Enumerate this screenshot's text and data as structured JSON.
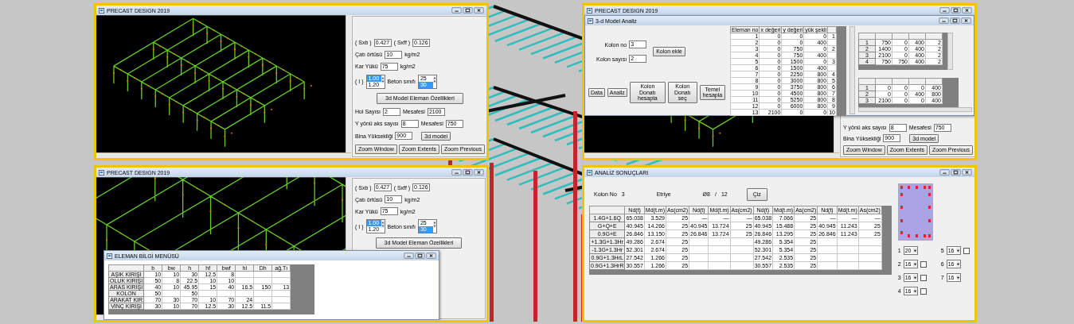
{
  "windows": [
    {
      "kind": "design",
      "title": "PRECAST DESIGN 2019",
      "panel": [
        {
          "kind": "pair",
          "items": [
            {
              "label": "( Sxb )",
              "value": "0.427"
            },
            {
              "label": "( Sxff )",
              "value": "0.126"
            }
          ]
        },
        {
          "kind": "field",
          "label": "Çatı örtüsü",
          "value": "10",
          "unit": "kg/m2"
        },
        {
          "kind": "field",
          "label": "Kar Yükü",
          "value": "75",
          "unit": "kg/m2"
        },
        {
          "kind": "lists",
          "items": [
            {
              "label": "( I )",
              "options": [
                {
                  "text": "1.00",
                  "selected": true
                },
                {
                  "text": "1.20",
                  "selected": false
                }
              ]
            },
            {
              "label": "Beton sınıfı",
              "options": [
                {
                  "text": "25",
                  "selected": false
                },
                {
                  "text": "30",
                  "selected": true
                }
              ]
            }
          ]
        },
        {
          "kind": "button",
          "label": "3d Model Eleman Özellikleri"
        },
        {
          "kind": "pair",
          "items": [
            {
              "label": "Hol Sayısı",
              "value": "2"
            },
            {
              "label": "Mesafesi",
              "value": "2100"
            }
          ]
        },
        {
          "kind": "pair",
          "items": [
            {
              "label": "Y yönü aks sayısı",
              "value": "8"
            },
            {
              "label": "Mesafesi",
              "value": "750"
            }
          ]
        },
        {
          "kind": "field-button",
          "label": "Bina Yüksekliği",
          "value": "900",
          "button": "3d model"
        },
        {
          "kind": "buttons",
          "labels": [
            "Zoom Window",
            "Zoom Extents",
            "Zoom Previous"
          ]
        }
      ]
    },
    {
      "kind": "design",
      "title": "PRECAST DESIGN 2019",
      "panel": [
        {
          "kind": "pair",
          "items": [
            {
              "label": "Y yönü aks sayısı",
              "value": "8"
            },
            {
              "label": "Mesafesi",
              "value": "750"
            }
          ]
        },
        {
          "kind": "field-button",
          "label": "Bina Yüksekliği",
          "value": "900",
          "button": "3d model"
        },
        {
          "kind": "buttons",
          "labels": [
            "Zoom Window",
            "Zoom Extents",
            "Zoom Previous"
          ]
        }
      ],
      "dialog": {
        "kind": "analysis",
        "title": "3-d Model Analiz",
        "fields": [
          {
            "label": "Kolon no",
            "value": "3"
          },
          {
            "label": "Kolon sayısı",
            "value": "2"
          }
        ],
        "side_button": "Kolon ekle",
        "buttons": [
          "Data",
          "Analiz",
          "Kolon Donatı hesapla",
          "Kolon Donatı seç",
          "Temel hesapla"
        ],
        "node_table": {
          "columns": [
            "Eleman no",
            "x değeri",
            "y değeri",
            "yük şekli"
          ],
          "rows": [
            [
              "1",
              "0",
              "0",
              "0",
              "1"
            ],
            [
              "2",
              "0",
              "0",
              "400",
              null
            ],
            [
              "3",
              "0",
              "750",
              "0",
              "2"
            ],
            [
              "4",
              "0",
              "750",
              "400",
              null
            ],
            [
              "5",
              "0",
              "1500",
              "0",
              "3"
            ],
            [
              "6",
              "0",
              "1500",
              "400",
              null
            ],
            [
              "7",
              "0",
              "2250",
              "800",
              "4"
            ],
            [
              "8",
              "0",
              "3000",
              "800",
              "5"
            ],
            [
              "9",
              "0",
              "3750",
              "800",
              "6"
            ],
            [
              "10",
              "0",
              "4500",
              "800",
              "7"
            ],
            [
              "11",
              "0",
              "5250",
              "800",
              "8"
            ],
            [
              "12",
              "0",
              "6000",
              "800",
              "9"
            ],
            [
              "13",
              "2100",
              "0",
              "0",
              "10"
            ]
          ]
        },
        "table_2": {
          "rows": [
            [
              "1",
              "750",
              "0",
              "400",
              "2"
            ],
            [
              "2",
              "1400",
              "0",
              "400",
              "2"
            ],
            [
              "3",
              "2100",
              "0",
              "400",
              "2"
            ],
            [
              "4",
              "750",
              "750",
              "400",
              "2"
            ]
          ]
        },
        "table_3": {
          "rows": [
            [
              "1",
              "0",
              "0",
              "0",
              "400"
            ],
            [
              "2",
              "0",
              "0",
              "400",
              "800"
            ],
            [
              "3",
              "2100",
              "0",
              "0",
              "400"
            ]
          ]
        }
      }
    },
    {
      "kind": "design",
      "title": "PRECAST DESIGN 2019",
      "panel": [
        {
          "kind": "pair",
          "items": [
            {
              "label": "( Sxb )",
              "value": "0.427"
            },
            {
              "label": "( Sxff )",
              "value": "0.126"
            }
          ]
        },
        {
          "kind": "field",
          "label": "Çatı örtüsü",
          "value": "10",
          "unit": "kg/m2"
        },
        {
          "kind": "field",
          "label": "Kar Yükü",
          "value": "75",
          "unit": "kg/m2"
        },
        {
          "kind": "lists",
          "items": [
            {
              "label": "( I )",
              "options": [
                {
                  "text": "1.00",
                  "selected": true
                },
                {
                  "text": "1.20",
                  "selected": false
                }
              ]
            },
            {
              "label": "Beton sınıfı",
              "options": [
                {
                  "text": "25",
                  "selected": false
                },
                {
                  "text": "30",
                  "selected": true
                }
              ]
            }
          ]
        },
        {
          "kind": "button",
          "label": "3d Model Eleman Özellikleri"
        }
      ],
      "dialog": {
        "kind": "elements",
        "title": "ELEMAN BİLGİ MENÜSÜ",
        "columns": [
          "b",
          "bw",
          "h",
          "hf",
          "bwf",
          "hi",
          "Dh",
          "ağ.Tı"
        ],
        "rows": [
          {
            "label": "AŞIK KİRİŞİ",
            "cells": [
              "10",
              "10",
              "30",
              "12.5",
              "8",
              null,
              null,
              null
            ]
          },
          {
            "label": "OLUK KİRİŞİ",
            "cells": [
              "50",
              "8",
              "22.5",
              "10",
              "10",
              null,
              null,
              null
            ]
          },
          {
            "label": "ARAS KİRİŞİ",
            "cells": [
              "40",
              "10",
              "45.95",
              "15",
              "40",
              "16.5",
              "150",
              "13"
            ]
          },
          {
            "label": "KOLON",
            "cells": [
              "50",
              null,
              "50",
              null,
              null,
              null,
              null,
              null
            ]
          },
          {
            "label": "ARAKAT KİR",
            "cells": [
              "70",
              "30",
              "70",
              "10",
              "70",
              "24",
              null,
              null
            ]
          },
          {
            "label": "VİNÇ KİRİŞİ",
            "cells": [
              "30",
              "10",
              "70",
              "12.5",
              "30",
              "12.5",
              "11.5",
              null
            ]
          }
        ]
      }
    },
    {
      "kind": "results",
      "title": "ANALİZ SONUÇLARI",
      "column_label": "Kolon No",
      "column_value": "3",
      "stirrup_label": "Etriye",
      "stirrup_diameter": "Ø8",
      "stirrup_separator": "/",
      "stirrup_spacing": "12",
      "draw_button": "Çiz",
      "columns": [
        "Nd(t)",
        "Md(t.m)",
        "As(cm2)",
        "Nd(t)",
        "Md(t.m)",
        "As(cm2)",
        "Nd(t)",
        "Md(t.m)",
        "As(cm2)",
        "Nd(t)",
        "Md(t.m)",
        "As(cm2)"
      ],
      "rows": [
        {
          "label": "1.4G+1.6Q",
          "cells": [
            "65.038",
            "3.529",
            "25",
            "—",
            "—",
            "—",
            "65.038",
            "7.066",
            "25",
            "—",
            "—",
            "—"
          ]
        },
        {
          "label": "G+Q+E",
          "cells": [
            "40.945",
            "14.266",
            "25",
            "40.945",
            "13.724",
            "25",
            "40.945",
            "15.488",
            "25",
            "40.945",
            "11.243",
            "25"
          ]
        },
        {
          "label": "0.9G+E",
          "cells": [
            "26.846",
            "13.150",
            "25",
            "26.846",
            "13.724",
            "25",
            "26.846",
            "13.295",
            "25",
            "26.846",
            "11.243",
            "25"
          ]
        },
        {
          "label": "+1.3G+1.3Hr",
          "cells": [
            "49.286",
            "2.674",
            "25",
            null,
            null,
            null,
            "49.286",
            "5.354",
            "25",
            null,
            null,
            null
          ]
        },
        {
          "label": "-1.3G+1.3Hr",
          "cells": [
            "52.301",
            "2.674",
            "25",
            null,
            null,
            null,
            "52.301",
            "5.354",
            "25",
            null,
            null,
            null
          ]
        },
        {
          "label": "0.9G+1.3HrL",
          "cells": [
            "27.542",
            "1.266",
            "25",
            null,
            null,
            null,
            "27.542",
            "2.535",
            "25",
            null,
            null,
            null
          ]
        },
        {
          "label": "0.9G+1.3HrR",
          "cells": [
            "30.557",
            "1.266",
            "25",
            null,
            null,
            null,
            "30.557",
            "2.535",
            "25",
            null,
            null,
            null
          ]
        }
      ],
      "bars": [
        {
          "label": "1",
          "value": "20"
        },
        {
          "label": "2",
          "value": "16",
          "checked": false
        },
        {
          "label": "3",
          "value": "16",
          "checked": false
        },
        {
          "label": "4",
          "value": "16",
          "checked": false
        },
        {
          "label": "5",
          "value": "16",
          "checked": false
        },
        {
          "label": "6",
          "value": "16"
        },
        {
          "label": "7",
          "value": "16"
        }
      ]
    }
  ]
}
